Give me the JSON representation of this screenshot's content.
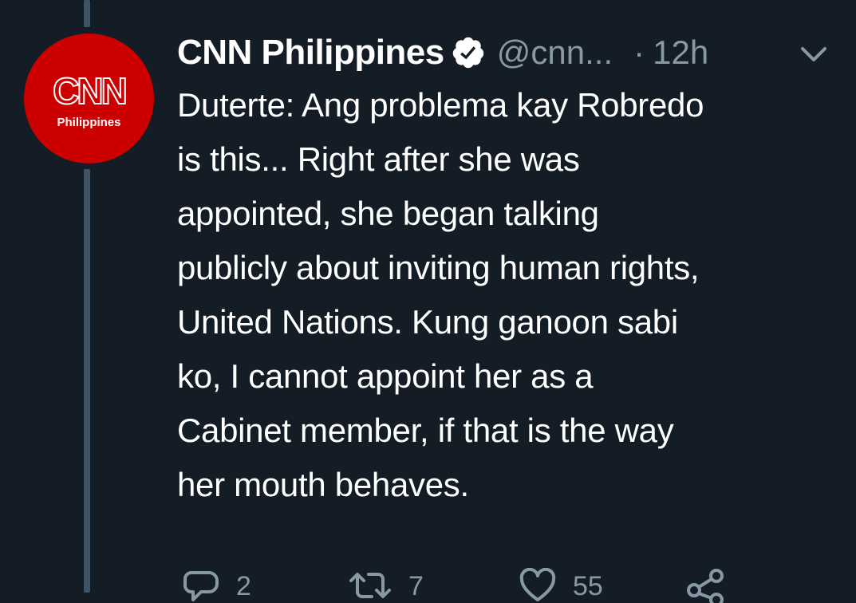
{
  "tweet": {
    "author": {
      "display_name": "CNN Philippines",
      "handle": "@cnn...",
      "verified": true,
      "avatar": {
        "logo_text": "CNN",
        "sub_text": "Philippines",
        "color": "#cc0000"
      }
    },
    "separator": "·",
    "timestamp": "12h",
    "text_lines": [
      "Duterte: Ang problema kay Robredo",
      "is this... Right after she was",
      "appointed, she began talking",
      "publicly about inviting human rights,",
      "United Nations. Kung ganoon sabi",
      "ko, I cannot appoint her as a",
      "Cabinet member, if that is the way",
      "her mouth behaves."
    ],
    "actions": {
      "reply_count": "2",
      "retweet_count": "7",
      "like_count": "55"
    }
  },
  "icons": {
    "verified": "verified-badge-icon",
    "menu": "chevron-down-icon",
    "reply": "reply-icon",
    "retweet": "retweet-icon",
    "like": "heart-icon",
    "share": "share-icon"
  },
  "colors": {
    "background": "#141d26",
    "thread_line": "#3d5466",
    "text_primary": "#ffffff",
    "text_secondary": "#8899a6"
  }
}
